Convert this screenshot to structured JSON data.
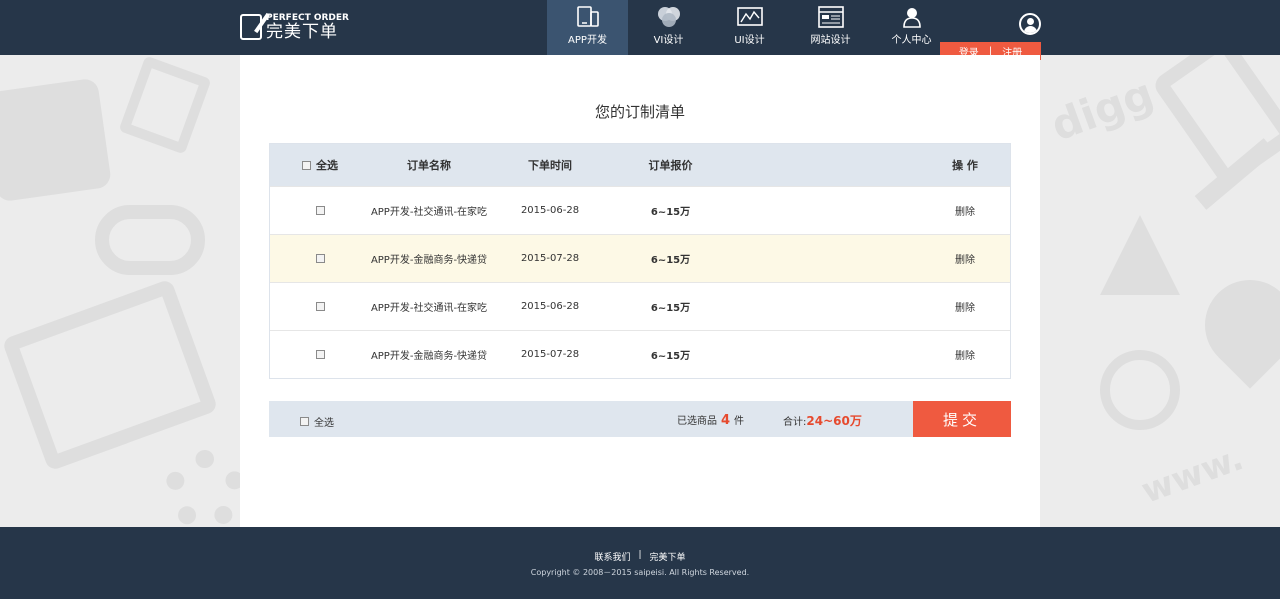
{
  "header": {
    "logo_en": "PERFECT ORDER",
    "logo_cn": "完美下单",
    "nav": [
      {
        "label": "APP开发",
        "icon": "mobile-app-icon",
        "active": true
      },
      {
        "label": "VI设计",
        "icon": "color-circles-icon",
        "active": false
      },
      {
        "label": "UI设计",
        "icon": "ui-chart-icon",
        "active": false
      },
      {
        "label": "网站设计",
        "icon": "website-icon",
        "active": false
      },
      {
        "label": "个人中心",
        "icon": "person-icon",
        "active": false
      }
    ],
    "login": "登录",
    "separator": "|",
    "register": "注册"
  },
  "main": {
    "title": "您的订制清单",
    "table": {
      "select_all_label": "全选",
      "columns": {
        "name": "订单名称",
        "time": "下单时间",
        "price": "订单报价",
        "operation": "操 作"
      },
      "rows": [
        {
          "name": "APP开发-社交通讯-在家吃",
          "time": "2015-06-28",
          "price": "6~15万",
          "operation": "删除",
          "highlight": false
        },
        {
          "name": "APP开发-金融商务-快递贷",
          "time": "2015-07-28",
          "price": "6~15万",
          "operation": "删除",
          "highlight": true
        },
        {
          "name": "APP开发-社交通讯-在家吃",
          "time": "2015-06-28",
          "price": "6~15万",
          "operation": "删除",
          "highlight": false
        },
        {
          "name": "APP开发-金融商务-快递贷",
          "time": "2015-07-28",
          "price": "6~15万",
          "operation": "删除",
          "highlight": false
        }
      ]
    },
    "summary": {
      "select_all_label": "全选",
      "selected_prefix": "已选商品",
      "selected_count": "4",
      "selected_unit": "件",
      "total_label": "合计:",
      "total_amount": "24~60万",
      "submit_label": "提交"
    }
  },
  "footer": {
    "contact": "联系我们",
    "sep": "|",
    "brand": "完美下单",
    "copyright": "Copyright © 2008－2015 saipeisi. All Rights Reserved."
  },
  "colors": {
    "header_bg": "#263649",
    "nav_active_bg": "#3b5470",
    "accent": "#ef5a40",
    "table_head_bg": "#dfe6ee",
    "row_highlight": "#fdf9e6"
  }
}
